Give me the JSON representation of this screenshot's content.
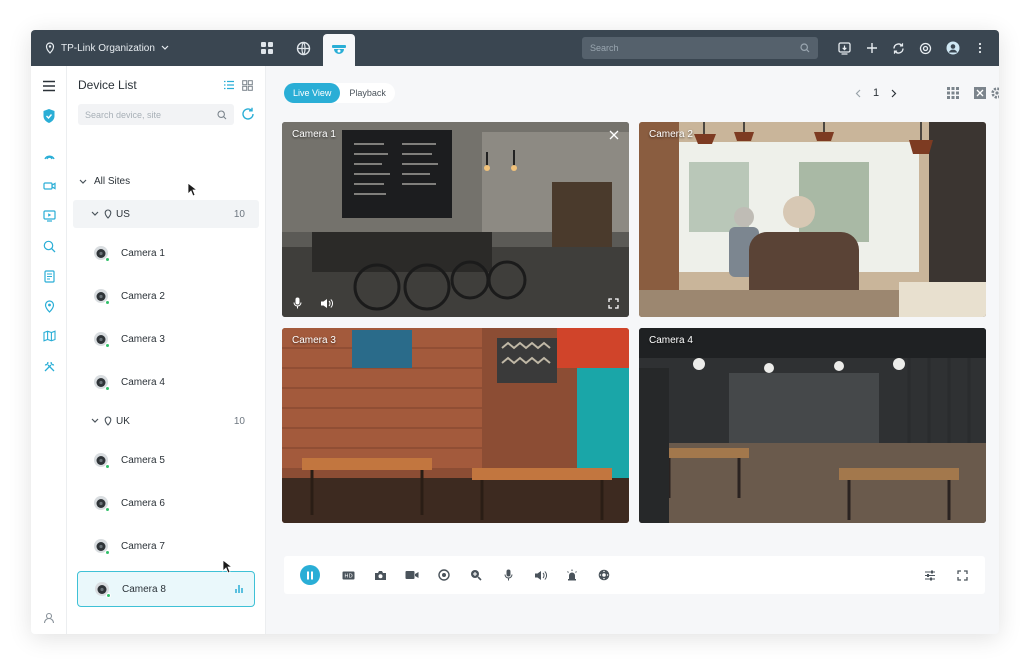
{
  "topbar": {
    "org_name": "TP-Link Organization",
    "search_placeholder": "Search"
  },
  "device_panel": {
    "title": "Device List",
    "search_placeholder": "Search device, site",
    "all_sites_label": "All Sites",
    "sites": [
      {
        "name": "US",
        "count": "10",
        "cameras": [
          "Camera 1",
          "Camera 2",
          "Camera 3",
          "Camera 4"
        ]
      },
      {
        "name": "UK",
        "count": "10",
        "cameras": [
          "Camera 5",
          "Camera 6",
          "Camera 7",
          "Camera 8"
        ]
      }
    ],
    "selected_camera": "Camera 8"
  },
  "main": {
    "tabs": [
      {
        "label": "Live View",
        "active": true
      },
      {
        "label": "Playback",
        "active": false
      }
    ],
    "page": "1",
    "tiles": [
      {
        "label": "Camera 1"
      },
      {
        "label": "Camera 2"
      },
      {
        "label": "Camera 3"
      },
      {
        "label": "Camera 4"
      }
    ]
  },
  "colors": {
    "accent": "#2aaed6",
    "topbar": "#3a4651",
    "online": "#33c06a"
  }
}
